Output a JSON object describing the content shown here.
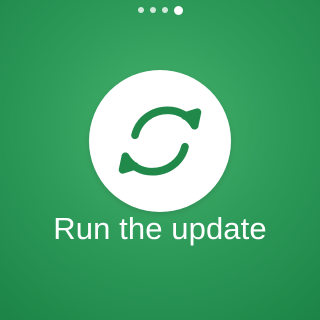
{
  "pager": {
    "dots": 4,
    "active_index": 3
  },
  "action": {
    "icon": "sync-icon",
    "label": "Run the update"
  },
  "colors": {
    "background": "#2f9c5b",
    "button": "#ffffff",
    "icon": "#218a4b",
    "text": "#ffffff"
  }
}
